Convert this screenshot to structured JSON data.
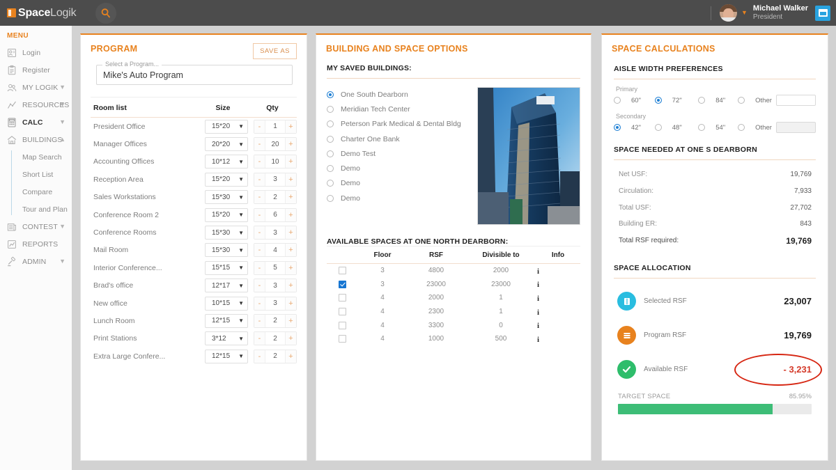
{
  "app": {
    "brand_first": "Space",
    "brand_second": "Logik",
    "accent": "#e8821e",
    "search_icon": "search-icon"
  },
  "user": {
    "name": "Michael Walker",
    "role": "President",
    "calendar_icon": "calendar-icon",
    "caret_icon": "chevron-down-icon"
  },
  "sidebar": {
    "title": "MENU",
    "items": [
      {
        "label": "Login",
        "icon": "user-card-icon",
        "chevron": "",
        "bold": false
      },
      {
        "label": "Register",
        "icon": "clipboard-icon",
        "chevron": "",
        "bold": false
      },
      {
        "label": "MY LOGIK",
        "icon": "people-icon",
        "chevron": "down",
        "bold": false
      },
      {
        "label": "RESOURCES",
        "icon": "chart-line-icon",
        "chevron": "down",
        "bold": false
      },
      {
        "label": "CALC",
        "icon": "calculator-icon",
        "chevron": "down",
        "bold": true
      },
      {
        "label": "BUILDINGS",
        "icon": "home-icon",
        "chevron": "up",
        "bold": false
      }
    ],
    "buildings_sub": [
      "Map Search",
      "Short List",
      "Compare",
      "Tour and Plan"
    ],
    "items_after": [
      {
        "label": "CONTEST",
        "icon": "news-icon",
        "chevron": "down",
        "bold": false
      },
      {
        "label": "REPORTS",
        "icon": "report-icon",
        "chevron": "",
        "bold": false
      },
      {
        "label": "ADMIN",
        "icon": "gavel-icon",
        "chevron": "down",
        "bold": false
      }
    ]
  },
  "program": {
    "title": "PROGRAM",
    "save_as_label": "SAVE AS",
    "select_legend": "Select a Program...",
    "selected_program": "Mike's Auto Program",
    "columns": [
      "Room list",
      "Size",
      "Qty"
    ],
    "rows": [
      {
        "name": "President Office",
        "size": "15*20",
        "qty": "1"
      },
      {
        "name": "Manager Offices",
        "size": "20*20",
        "qty": "20"
      },
      {
        "name": "Accounting Offices",
        "size": "10*12",
        "qty": "10"
      },
      {
        "name": "Reception Area",
        "size": "15*20",
        "qty": "3"
      },
      {
        "name": "Sales Workstations",
        "size": "15*30",
        "qty": "2"
      },
      {
        "name": "Conference Room 2",
        "size": "15*20",
        "qty": "6"
      },
      {
        "name": "Conference Rooms",
        "size": "15*30",
        "qty": "3"
      },
      {
        "name": "Mail Room",
        "size": "15*30",
        "qty": "4"
      },
      {
        "name": "Interior Conference...",
        "size": "15*15",
        "qty": "5"
      },
      {
        "name": "Brad's office",
        "size": "12*17",
        "qty": "3"
      },
      {
        "name": "New office",
        "size": "10*15",
        "qty": "3"
      },
      {
        "name": "Lunch Room",
        "size": "12*15",
        "qty": "2"
      },
      {
        "name": "Print Stations",
        "size": "3*12",
        "qty": "2"
      },
      {
        "name": "Extra Large Confere...",
        "size": "12*15",
        "qty": "2"
      }
    ],
    "stepper_minus": "-",
    "stepper_plus": "+"
  },
  "building": {
    "title": "BUILDING AND SPACE OPTIONS",
    "saved_label": "MY SAVED BUILDINGS:",
    "saved_buildings": [
      {
        "label": "One South Dearborn",
        "selected": true
      },
      {
        "label": "Meridian Tech Center",
        "selected": false
      },
      {
        "label": "Peterson Park Medical & Dental Bldg",
        "selected": false
      },
      {
        "label": "Charter One Bank",
        "selected": false
      },
      {
        "label": "Demo Test",
        "selected": false
      },
      {
        "label": "Demo",
        "selected": false
      },
      {
        "label": "Demo",
        "selected": false
      },
      {
        "label": "Demo",
        "selected": false
      }
    ],
    "photo_alt": "building-photo",
    "spaces_label": "AVAILABLE SPACES AT ONE NORTH DEARBORN:",
    "spaces_columns": [
      "",
      "Floor",
      "RSF",
      "Divisible to",
      "Info"
    ],
    "spaces_rows": [
      {
        "checked": false,
        "floor": "3",
        "rsf": "4800",
        "divisible": "2000",
        "info": "info-icon"
      },
      {
        "checked": true,
        "floor": "3",
        "rsf": "23000",
        "divisible": "23000",
        "info": "info-icon"
      },
      {
        "checked": false,
        "floor": "4",
        "rsf": "2000",
        "divisible": "1",
        "info": "info-icon"
      },
      {
        "checked": false,
        "floor": "4",
        "rsf": "2300",
        "divisible": "1",
        "info": "info-icon"
      },
      {
        "checked": false,
        "floor": "4",
        "rsf": "3300",
        "divisible": "0",
        "info": "info-icon"
      },
      {
        "checked": false,
        "floor": "4",
        "rsf": "1000",
        "divisible": "500",
        "info": "info-icon"
      }
    ]
  },
  "calc": {
    "title": "SPACE CALCULATIONS",
    "aisle_title": "AISLE WIDTH PREFERENCES",
    "primary_caption": "Primary",
    "primary_options": [
      {
        "label": "60\"",
        "selected": false
      },
      {
        "label": "72\"",
        "selected": true
      },
      {
        "label": "84\"",
        "selected": false
      },
      {
        "label": "Other",
        "selected": false
      }
    ],
    "primary_other_value": "",
    "secondary_caption": "Secondary",
    "secondary_options": [
      {
        "label": "42\"",
        "selected": true
      },
      {
        "label": "48\"",
        "selected": false
      },
      {
        "label": "54\"",
        "selected": false
      },
      {
        "label": "Other",
        "selected": false
      }
    ],
    "secondary_other_value": "",
    "needed_title": "SPACE NEEDED AT ONE S DEARBORN",
    "needed_rows": [
      {
        "label": "Net USF:",
        "value": "19,769"
      },
      {
        "label": "Circulation:",
        "value": "7,933"
      },
      {
        "label": "Total USF:",
        "value": "27,702"
      },
      {
        "label": "Building ER:",
        "value": "843"
      }
    ],
    "needed_total": {
      "label": "Total RSF required:",
      "value": "19,769"
    },
    "allocation_title": "SPACE ALLOCATION",
    "allocation_rows": [
      {
        "label": "Selected RSF",
        "value": "23,007",
        "icon": "book-icon",
        "color": "#29bde0",
        "negative": false,
        "circled": false
      },
      {
        "label": "Program RSF",
        "value": "19,769",
        "icon": "list-icon",
        "color": "#e8821e",
        "negative": false,
        "circled": false
      },
      {
        "label": "Available RSF",
        "value": "- 3,231",
        "icon": "check-icon",
        "color": "#2ebd6b",
        "negative": true,
        "circled": true
      }
    ],
    "target_label": "TARGET SPACE",
    "target_percent": "85.95%",
    "target_fill": 80
  }
}
